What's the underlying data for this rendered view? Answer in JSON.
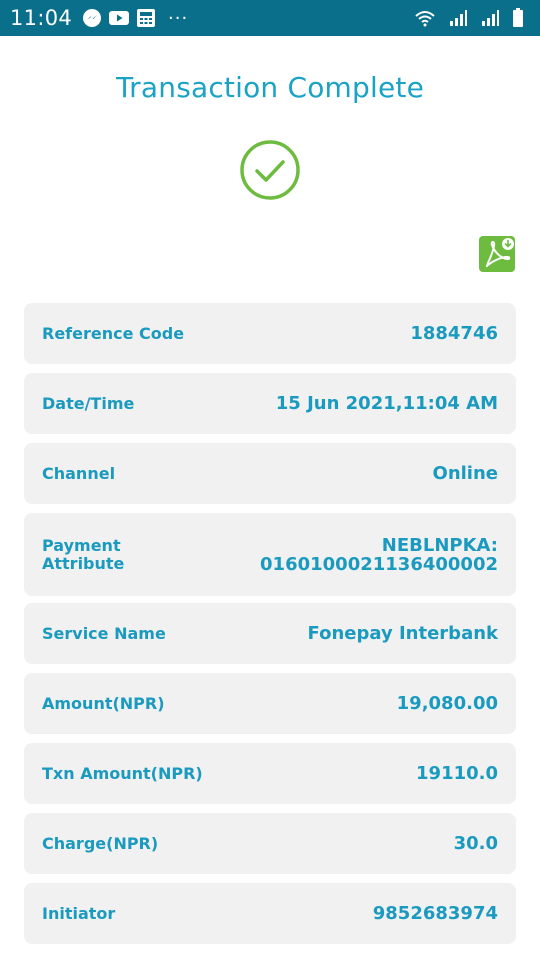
{
  "status_bar": {
    "time": "11:04",
    "left_icons": [
      "messenger-icon",
      "youtube-icon",
      "calculator-app-icon"
    ],
    "more": "···",
    "right_icons": [
      "wifi-icon",
      "signal-icon",
      "signal-icon",
      "battery-icon"
    ]
  },
  "page": {
    "title": "Transaction Complete",
    "success_icon": "check-circle-icon",
    "download_icon": "pdf-download-icon"
  },
  "details": [
    {
      "label": "Reference Code",
      "value": "1884746"
    },
    {
      "label": "Date/Time",
      "value": "15 Jun 2021,11:04 AM"
    },
    {
      "label": "Channel",
      "value": "Online"
    },
    {
      "label": "Payment Attribute",
      "value": "NEBLNPKA:\n0160100021136400002",
      "label_line1": "Payment",
      "label_line2": "Attribute",
      "value_line1": "NEBLNPKA:",
      "value_line2": "0160100021136400002"
    },
    {
      "label": "Service Name",
      "value": "Fonepay Interbank"
    },
    {
      "label": "Amount(NPR)",
      "value": "19,080.00"
    },
    {
      "label": "Txn Amount(NPR)",
      "value": "19110.0"
    },
    {
      "label": "Charge(NPR)",
      "value": "30.0"
    },
    {
      "label": "Initiator",
      "value": "9852683974"
    }
  ],
  "colors": {
    "status_bar": "#0a6f8a",
    "accent": "#1aa3c6",
    "success": "#6dbb3f",
    "row_bg": "#f1f1f1"
  }
}
